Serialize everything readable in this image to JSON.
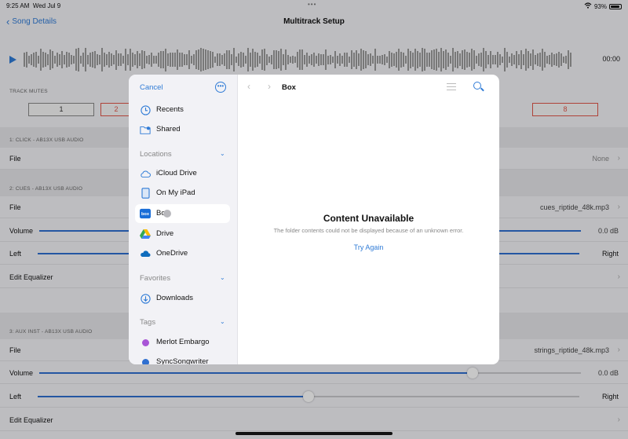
{
  "status": {
    "time": "9:25 AM",
    "date": "Wed Jul 9",
    "battery": "93%",
    "battery_level": 0.93
  },
  "nav": {
    "back_label": "Song Details",
    "title": "Multitrack Setup"
  },
  "transport": {
    "time": "00:00"
  },
  "track_mutes": {
    "header": "TRACK MUTES",
    "buttons": [
      {
        "label": "1",
        "muted": false
      },
      {
        "label": "2",
        "muted": true
      },
      {
        "label": "8",
        "muted": true
      }
    ]
  },
  "tracks": [
    {
      "header": "1: CLICK - AB13X USB AUDIO",
      "file_label": "File",
      "file_value": "None"
    },
    {
      "header": "2: CUES - AB13X USB AUDIO",
      "file_label": "File",
      "file_value": "cues_riptide_48k.mp3",
      "volume_label": "Volume",
      "volume_value": "0.0 dB",
      "pan_left": "Left",
      "pan_right": "Right",
      "eq_label": "Edit Equalizer"
    },
    {
      "header": "3: AUX INST - AB13X USB AUDIO",
      "file_label": "File",
      "file_value": "strings_riptide_48k.mp3",
      "volume_label": "Volume",
      "volume_value": "0.0 dB",
      "volume_level": 0.8,
      "pan_left": "Left",
      "pan_right": "Right",
      "pan_level": 0.5,
      "eq_label": "Edit Equalizer"
    }
  ],
  "picker": {
    "cancel_label": "Cancel",
    "sidebar": {
      "top_items": [
        {
          "label": "Recents",
          "icon": "clock-icon"
        },
        {
          "label": "Shared",
          "icon": "shared-folder-icon"
        }
      ],
      "locations_header": "Locations",
      "locations": [
        {
          "label": "iCloud Drive",
          "icon": "icloud-icon"
        },
        {
          "label": "On My iPad",
          "icon": "ipad-icon"
        },
        {
          "label": "Box",
          "icon": "box-icon",
          "selected": true
        },
        {
          "label": "Drive",
          "icon": "google-drive-icon"
        },
        {
          "label": "OneDrive",
          "icon": "onedrive-icon"
        }
      ],
      "favorites_header": "Favorites",
      "favorites": [
        {
          "label": "Downloads",
          "icon": "download-icon"
        }
      ],
      "tags_header": "Tags",
      "tags": [
        {
          "label": "Merlot Embargo",
          "color": "#a855d6"
        },
        {
          "label": "SyncSongwriter",
          "color": "#2f6fd0"
        }
      ]
    },
    "content": {
      "title": "Box",
      "empty_title": "Content Unavailable",
      "empty_message": "The folder contents could not be displayed because of an unknown error.",
      "retry_label": "Try Again"
    }
  },
  "colors": {
    "accent": "#2f7bd6",
    "mute_on": "#e0564a"
  }
}
